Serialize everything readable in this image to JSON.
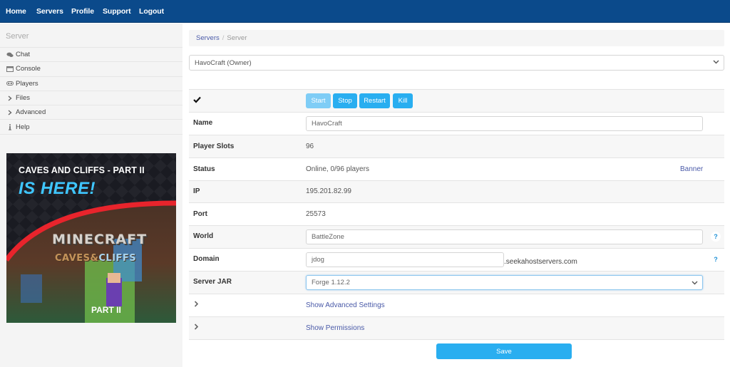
{
  "nav": {
    "items": [
      {
        "label": "Home"
      },
      {
        "label": "Servers"
      },
      {
        "label": "Profile"
      },
      {
        "label": "Support"
      },
      {
        "label": "Logout"
      }
    ],
    "background": "#0b4a8b"
  },
  "sidebar": {
    "title": "Server",
    "items": [
      {
        "label": "Chat",
        "icon": "chat-icon"
      },
      {
        "label": "Console",
        "icon": "console-icon"
      },
      {
        "label": "Players",
        "icon": "players-icon"
      },
      {
        "label": "Files",
        "icon": "chevron-right-icon"
      },
      {
        "label": "Advanced",
        "icon": "chevron-right-icon"
      },
      {
        "label": "Help",
        "icon": "info-icon"
      }
    ],
    "banner": {
      "line1": "CAVES AND CLIFFS - PART II",
      "line2": "IS HERE!",
      "logo_title": "MINECRAFT",
      "logo_sub_left": "CAVES&",
      "logo_sub_right": "CLIFFS",
      "part": "PART II"
    }
  },
  "breadcrumb": {
    "link": "Servers",
    "separator": "/",
    "current": "Server"
  },
  "server_select": {
    "selected": "HavoCraft (Owner)"
  },
  "controls": {
    "status_icon": "checkmark-icon",
    "buttons": [
      {
        "label": "Start",
        "disabled": true
      },
      {
        "label": "Stop",
        "disabled": false
      },
      {
        "label": "Restart",
        "disabled": false
      },
      {
        "label": "Kill",
        "disabled": false
      }
    ],
    "accent": "#29aef0"
  },
  "fields": {
    "name": {
      "label": "Name",
      "value": "HavoCraft"
    },
    "player_slots": {
      "label": "Player Slots",
      "value": "96"
    },
    "status": {
      "label": "Status",
      "value": "Online, 0/96 players",
      "link": "Banner"
    },
    "ip": {
      "label": "IP",
      "value": "195.201.82.99"
    },
    "port": {
      "label": "Port",
      "value": "25573"
    },
    "world": {
      "label": "World",
      "value": "BattleZone",
      "help": "?"
    },
    "domain": {
      "label": "Domain",
      "value": "jdog",
      "suffix": ".seekahostservers.com",
      "help": "?"
    },
    "server_jar": {
      "label": "Server JAR",
      "selected": "Forge 1.12.2"
    }
  },
  "expanders": {
    "advanced": "Show Advanced Settings",
    "permissions": "Show Permissions"
  },
  "save_label": "Save"
}
